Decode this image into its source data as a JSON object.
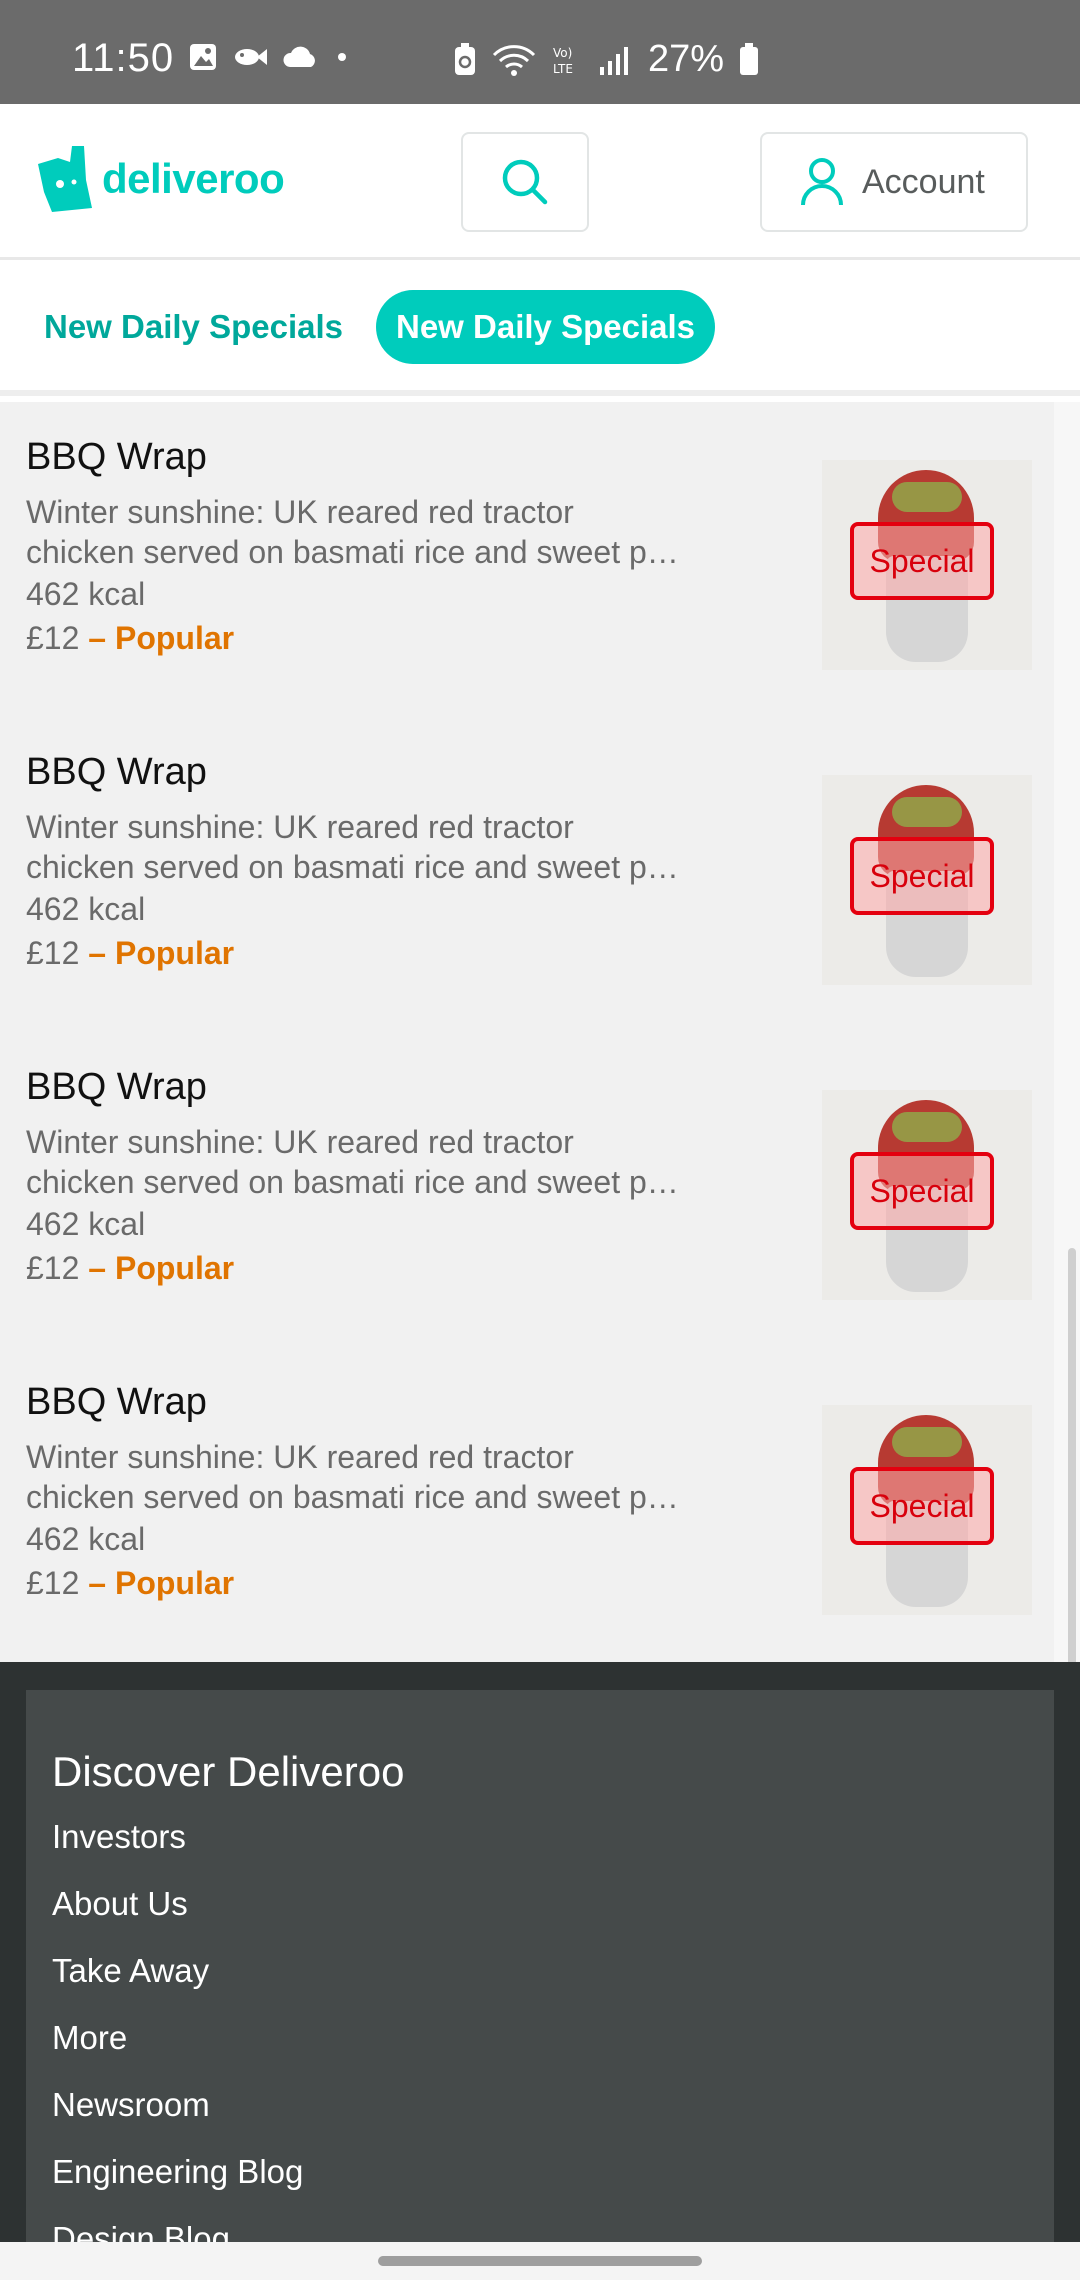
{
  "status_bar": {
    "time": "11:50",
    "battery": "27%",
    "icons_left": [
      "gallery-icon",
      "fish-icon",
      "cloud-icon",
      "dot-icon"
    ],
    "icons_right": [
      "battery-saver-icon",
      "wifi-icon",
      "volte-icon",
      "signal-icon",
      "battery-icon"
    ]
  },
  "header": {
    "logo_text": "deliveroo",
    "account_label": "Account",
    "brand_color": "#00ccbc"
  },
  "categories": {
    "link_label": "New Daily Specials",
    "active_label": "New Daily Specials"
  },
  "menu_items": [
    {
      "name": "BBQ Wrap",
      "desc_line1": "Winter sunshine: UK reared red tractor",
      "desc_line2": "chicken served on basmati rice and sweet p…",
      "kcal": "462 kcal",
      "price": "£12",
      "tag": " – Popular",
      "badge": "Special"
    },
    {
      "name": "BBQ Wrap",
      "desc_line1": "Winter sunshine: UK reared red tractor",
      "desc_line2": "chicken served on basmati rice and sweet p…",
      "kcal": "462 kcal",
      "price": "£12",
      "tag": " – Popular",
      "badge": "Special"
    },
    {
      "name": "BBQ Wrap",
      "desc_line1": "Winter sunshine: UK reared red tractor",
      "desc_line2": "chicken served on basmati rice and sweet p…",
      "kcal": "462 kcal",
      "price": "£12",
      "tag": " – Popular",
      "badge": "Special"
    },
    {
      "name": "BBQ Wrap",
      "desc_line1": "Winter sunshine: UK reared red tractor",
      "desc_line2": "chicken served on basmati rice and sweet p…",
      "kcal": "462 kcal",
      "price": "£12",
      "tag": " – Popular",
      "badge": "Special"
    }
  ],
  "footer": {
    "title": "Discover Deliveroo",
    "links": [
      "Investors",
      "About Us",
      "Take Away",
      "More",
      "Newsroom",
      "Engineering Blog",
      "Design Blog"
    ]
  }
}
